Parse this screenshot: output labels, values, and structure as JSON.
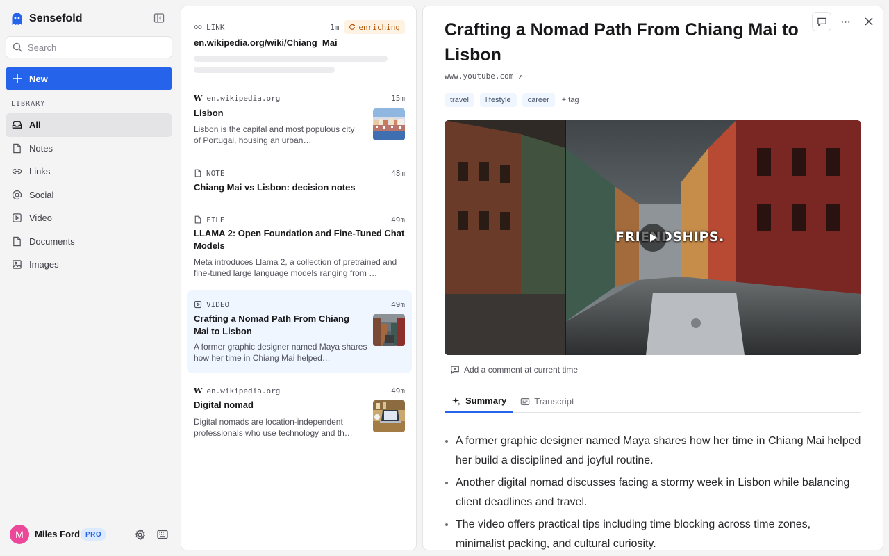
{
  "app": {
    "name": "Sensefold"
  },
  "search": {
    "placeholder": "Search"
  },
  "new_button": {
    "label": "New"
  },
  "library": {
    "label": "LIBRARY",
    "items": [
      {
        "label": "All",
        "icon": "inbox-icon",
        "active": true
      },
      {
        "label": "Notes",
        "icon": "file-icon"
      },
      {
        "label": "Links",
        "icon": "link-icon"
      },
      {
        "label": "Social",
        "icon": "at-icon"
      },
      {
        "label": "Video",
        "icon": "video-icon"
      },
      {
        "label": "Documents",
        "icon": "document-icon"
      },
      {
        "label": "Images",
        "icon": "image-icon"
      }
    ]
  },
  "user": {
    "initial": "M",
    "name": "Miles Ford",
    "plan": "PRO",
    "avatar_color": "#ec4899"
  },
  "list": {
    "items": [
      {
        "type": "LINK",
        "time": "1m",
        "status": "enriching",
        "title": "en.wikipedia.org/wiki/Chiang_Mai"
      },
      {
        "type": "en.wikipedia.org",
        "time": "15m",
        "title": "Lisbon",
        "desc": "Lisbon is the capital and most populous city of Portugal, housing an urban…"
      },
      {
        "type": "NOTE",
        "time": "48m",
        "title": "Chiang Mai vs Lisbon: decision notes"
      },
      {
        "type": "FILE",
        "time": "49m",
        "title": "LLAMA 2: Open Foundation and Fine-Tuned Chat Models",
        "desc": "Meta introduces Llama 2, a collection of pretrained and fine-tuned large language models ranging from …"
      },
      {
        "type": "VIDEO",
        "time": "49m",
        "title": "Crafting a Nomad Path From Chiang Mai to Lisbon",
        "desc": "A former graphic designer named Maya shares how her time in Chiang Mai helped…",
        "selected": true
      },
      {
        "type": "en.wikipedia.org",
        "time": "49m",
        "title": "Digital nomad",
        "desc": "Digital nomads are location-independent professionals who use technology and th…"
      }
    ]
  },
  "detail": {
    "title": "Crafting a Nomad Path From Chiang Mai to Lisbon",
    "source": "www.youtube.com ↗",
    "tags": [
      "travel",
      "lifestyle",
      "career"
    ],
    "add_tag": "tag",
    "video_caption": "FRIENDSHIPS.",
    "comment_label": "Add a comment at current time",
    "tabs": [
      "Summary",
      "Transcript"
    ],
    "summary": [
      "A former graphic designer named Maya shares how her time in Chiang Mai helped her build a disciplined and joyful routine.",
      "Another digital nomad discusses facing a stormy week in Lisbon while balancing client deadlines and travel.",
      "The video offers practical tips including time blocking across time zones, minimalist packing, and cultural curiosity."
    ]
  },
  "colors": {
    "accent": "#2563eb",
    "enriching_bg": "#fef3e2",
    "enriching_text": "#b45309",
    "tag_bg": "#eff6ff",
    "selected_bg": "#eff6ff"
  }
}
